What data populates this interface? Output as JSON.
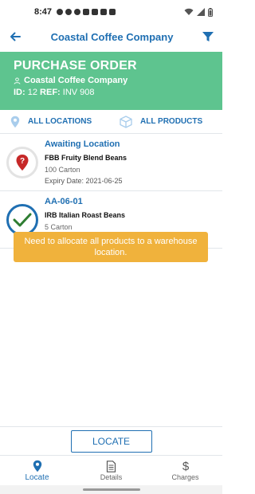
{
  "status_bar": {
    "time": "8:47"
  },
  "header": {
    "title": "Coastal Coffee Company"
  },
  "banner": {
    "heading": "PURCHASE ORDER",
    "company": "Coastal Coffee Company",
    "id_label": "ID:",
    "id_value": "12",
    "ref_label": "REF:",
    "ref_value": "INV 908"
  },
  "filters": {
    "locations": "ALL LOCATIONS",
    "products": "ALL PRODUCTS"
  },
  "items": [
    {
      "location": "Awaiting Location",
      "product": "FBB Fruity Blend Beans",
      "quantity": "100 Carton",
      "expiry": "Expiry Date: 2021-06-25",
      "icon": "question-pin-icon"
    },
    {
      "location": "AA-06-01",
      "product": "IRB Italian Roast Beans",
      "quantity": "5 Carton",
      "icon": "check-icon"
    }
  ],
  "toast": {
    "message": "Need to allocate all products to a warehouse location."
  },
  "action": {
    "locate_label": "LOCATE"
  },
  "tabs": [
    {
      "label": "Locate",
      "icon": "map-pin-icon",
      "active": true
    },
    {
      "label": "Details",
      "icon": "document-icon",
      "active": false
    },
    {
      "label": "Charges",
      "icon": "dollar-icon",
      "active": false
    }
  ],
  "colors": {
    "primary": "#1f6fb2",
    "banner": "#5ec48f",
    "toast": "#f0b23c",
    "check": "#2e7d32",
    "question": "#c62828"
  }
}
